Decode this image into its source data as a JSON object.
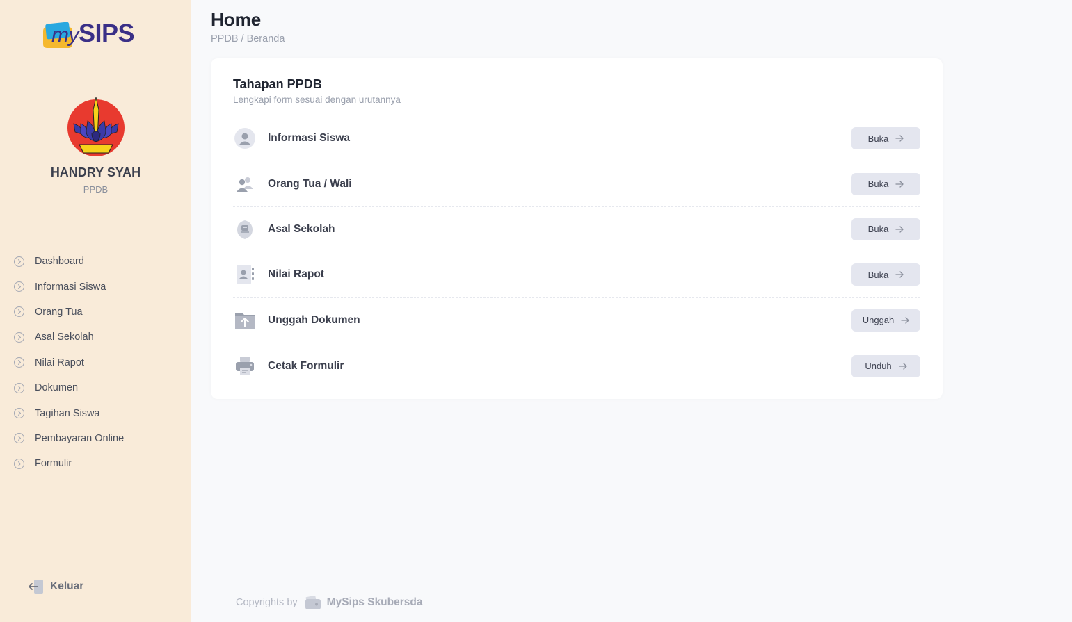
{
  "sidebar": {
    "logo": {
      "prefix": "my",
      "name": "SIPS"
    },
    "user": {
      "name": "HANDRY SYAH",
      "role": "PPDB"
    },
    "items": [
      {
        "label": "Dashboard"
      },
      {
        "label": "Informasi Siswa"
      },
      {
        "label": "Orang Tua"
      },
      {
        "label": "Asal Sekolah"
      },
      {
        "label": "Nilai Rapot"
      },
      {
        "label": "Dokumen"
      },
      {
        "label": "Tagihan Siswa"
      },
      {
        "label": "Pembayaran Online"
      },
      {
        "label": "Formulir"
      }
    ],
    "logout_label": "Keluar"
  },
  "header": {
    "title": "Home",
    "breadcrumb": "PPDB / Beranda"
  },
  "card": {
    "title": "Tahapan PPDB",
    "subtitle": "Lengkapi form sesuai dengan urutannya",
    "steps": [
      {
        "label": "Informasi Siswa",
        "button": "Buka",
        "icon": "user-circle-icon"
      },
      {
        "label": "Orang Tua / Wali",
        "button": "Buka",
        "icon": "users-icon"
      },
      {
        "label": "Asal Sekolah",
        "button": "Buka",
        "icon": "school-badge-icon"
      },
      {
        "label": "Nilai Rapot",
        "button": "Buka",
        "icon": "address-book-icon"
      },
      {
        "label": "Unggah Dokumen",
        "button": "Unggah",
        "icon": "folder-upload-icon"
      },
      {
        "label": "Cetak Formulir",
        "button": "Unduh",
        "icon": "printer-icon"
      }
    ]
  },
  "footer": {
    "text": "Copyrights by",
    "brand": "MySips Skubersda"
  },
  "colors": {
    "sidebar_bg": "#f9ebd9",
    "main_bg": "#f8f9fb",
    "button_bg": "#e4e6ef",
    "brand_purple": "#3a2f87",
    "icon_gray": "#c2c6d2"
  }
}
